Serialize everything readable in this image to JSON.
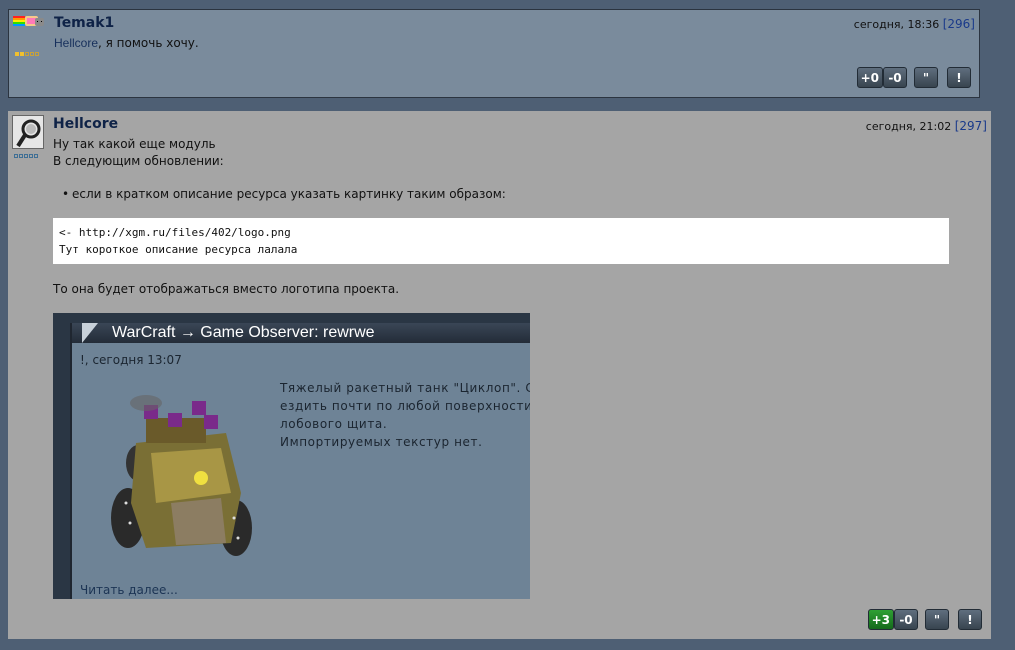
{
  "post1": {
    "author": "Temak1",
    "mention": "Hellcore",
    "text": ", я помочь хочу.",
    "time": "сегодня, 18:36",
    "number": "[296]",
    "rate_plus": "+0",
    "rate_minus": "-0",
    "quote_label": "\"",
    "report_label": "!",
    "avatar_icon": "nyan-cat-icon",
    "rank_color": "#f0c030"
  },
  "post2": {
    "author": "Hellcore",
    "time": "сегодня, 21:02",
    "number": "[297]",
    "line1": "Ну так какой еще модуль",
    "line2": "В следующим обновлении:",
    "bullet": "если в кратком описание ресурса указать картинку таким образом:",
    "code_line1": "<- http://xgm.ru/files/402/logo.png",
    "code_line2": "Тут короткое описание ресурса лалала",
    "after_code": "То она будет отображаться вместо логотипа проекта.",
    "embed": {
      "title": "WarCraft → Game Observer: rewrwe",
      "date": "!, сегодня 13:07",
      "desc_line1": "Тяжелый ракетный танк \"Циклоп\". Сп",
      "desc_line2": "ездить почти по любой поверхности",
      "desc_line3": "лобового щита.",
      "desc_line4": "Импортируемых текстур нет.",
      "read_more": "Читать далее..."
    },
    "rate_plus": "+3",
    "rate_minus": "-0",
    "quote_label": "\"",
    "report_label": "!",
    "avatar_icon": "magnifier-avatar-icon",
    "plus_color": "#2fa034"
  }
}
